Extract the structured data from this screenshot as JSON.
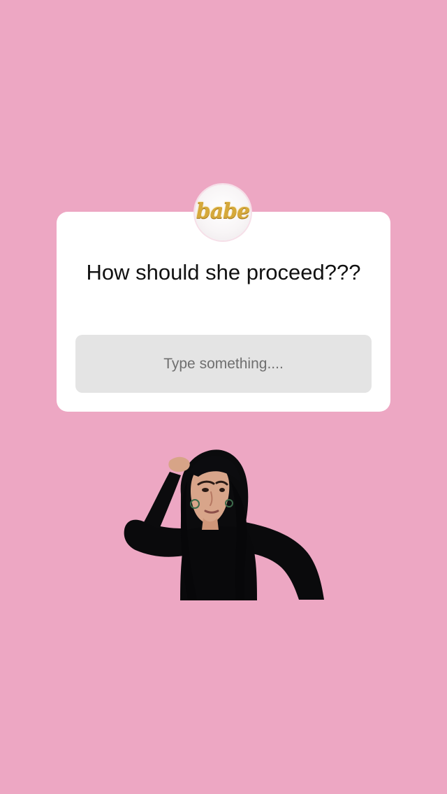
{
  "app": {
    "background_color": "#eda7c3",
    "card_color": "#ffffff",
    "input_color": "#e4e4e4"
  },
  "question_sticker": {
    "avatar_text": "babe",
    "title": "How should she proceed???",
    "placeholder": "Type something...."
  },
  "sticker": {
    "icon": "woman-thinking-sticker"
  }
}
